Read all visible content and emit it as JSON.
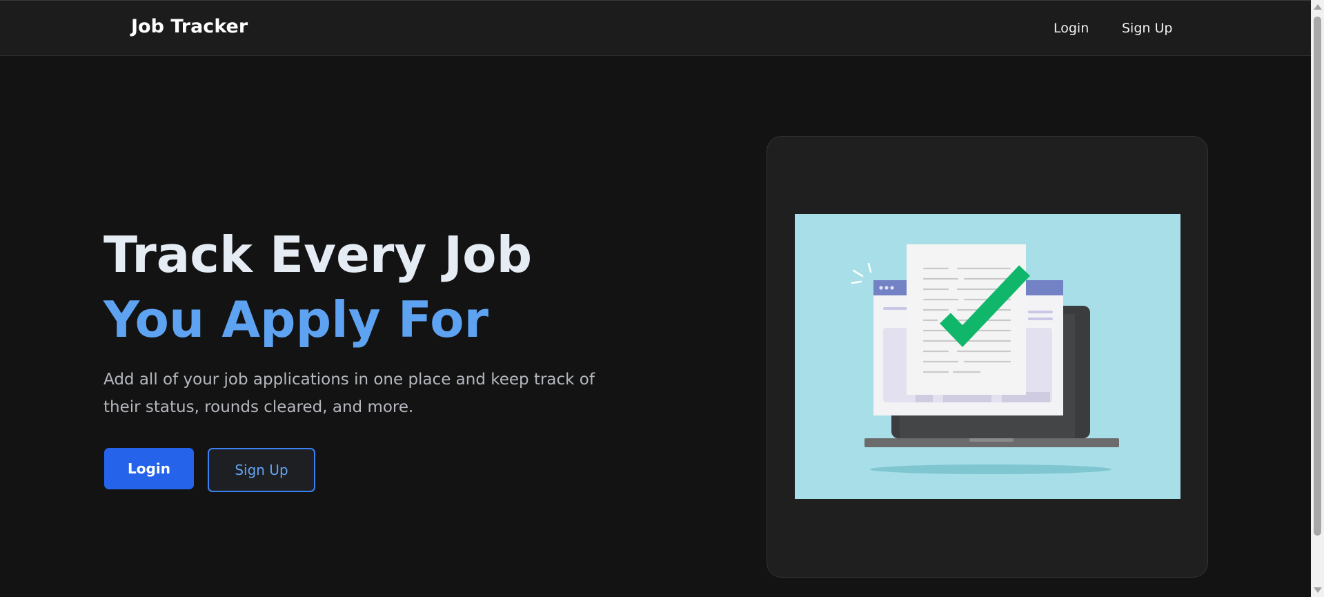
{
  "navbar": {
    "brand": "Job Tracker",
    "login_label": "Login",
    "signup_label": "Sign Up"
  },
  "hero": {
    "headline_line1": "Track Every Job",
    "headline_line2": "You Apply For",
    "subtext": "Add all of your job applications in one place and keep track of their status, rounds cleared, and more.",
    "login_button": "Login",
    "signup_button": "Sign Up"
  },
  "illustration": {
    "icon": "laptop-document-checkmark-illustration"
  },
  "colors": {
    "background": "#131313",
    "navbar": "#1c1c1c",
    "accent": "#2563eb",
    "headline_accent": "#5ea3f2",
    "illustration_bg": "#a7dee7",
    "check": "#12b76a"
  }
}
